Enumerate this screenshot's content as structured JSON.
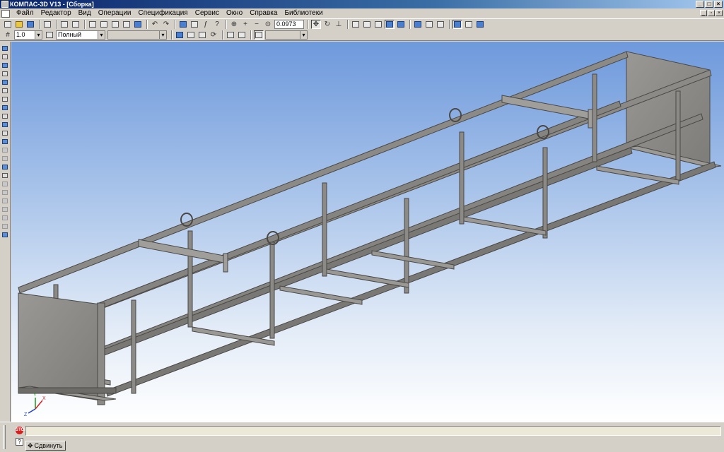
{
  "window": {
    "title": "КОМПАС-3D V13 - [Сборка]"
  },
  "menu": [
    "Файл",
    "Редактор",
    "Вид",
    "Операции",
    "Спецификация",
    "Сервис",
    "Окно",
    "Справка",
    "Библиотеки"
  ],
  "toolbar": {
    "zoom_value": "0.0973"
  },
  "properties_bar": {
    "step_value": "1.0",
    "style_value": "Полный"
  },
  "status": {
    "prompt_text": "",
    "shift_button_label": "Сдвинуть"
  },
  "axes": {
    "x_label": "X",
    "y_label": "Y",
    "z_label": "Z"
  },
  "colors": {
    "steel": "#8c8a86",
    "steel_dark": "#5a5855",
    "steel_light": "#b8b6b2",
    "accent": "#0a246a"
  }
}
